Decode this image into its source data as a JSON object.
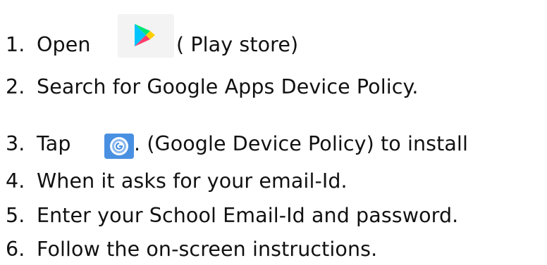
{
  "steps": [
    {
      "num": "1.",
      "before": "Open",
      "after": " ( Play store)"
    },
    {
      "num": "2.",
      "text": "Search for Google Apps Device Policy."
    },
    {
      "num": "3.",
      "before": "Tap",
      "after": ". (Google Device Policy) to install"
    },
    {
      "num": "4.",
      "text": "When it asks for your email-Id."
    },
    {
      "num": "5.",
      "text": "Enter your School Email-Id and password."
    },
    {
      "num": "6.",
      "text": "Follow the on-screen instructions."
    }
  ],
  "icons": {
    "play_store": "play-store-icon",
    "device_policy": "google-device-policy-icon"
  },
  "colors": {
    "text": "#111111",
    "policy_icon_bg": "#4a90e2"
  }
}
